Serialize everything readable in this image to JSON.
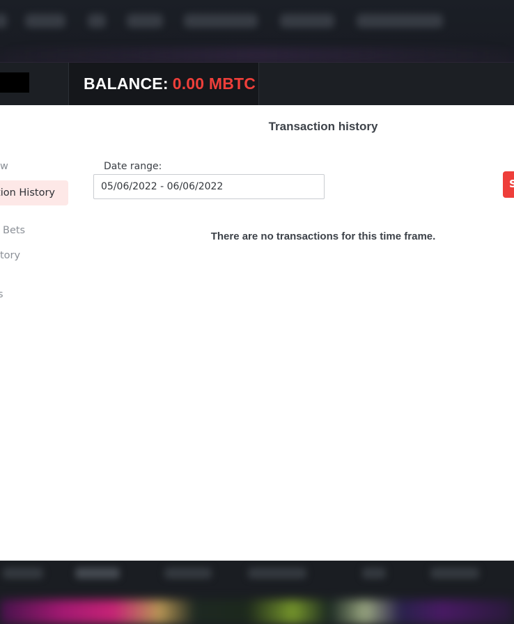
{
  "balance": {
    "label": "BALANCE:",
    "value": "0.00 MBTC",
    "value_color": "#ef3f3a"
  },
  "sidebar": {
    "items": [
      {
        "label": "w"
      },
      {
        "label": "tion History",
        "active": true
      },
      {
        "label": "Bets"
      },
      {
        "label": "tory"
      },
      {
        "label": "s"
      }
    ]
  },
  "main": {
    "title": "Transaction history",
    "date_range_label": "Date range:",
    "date_range_value": "05/06/2022 - 06/06/2022",
    "empty_message": "There are no transactions for this time frame.",
    "action_button_label": "S"
  },
  "colors": {
    "accent": "#ee3e3a",
    "active_bg": "#fde8e7",
    "dark_bg": "#1c1f24"
  }
}
